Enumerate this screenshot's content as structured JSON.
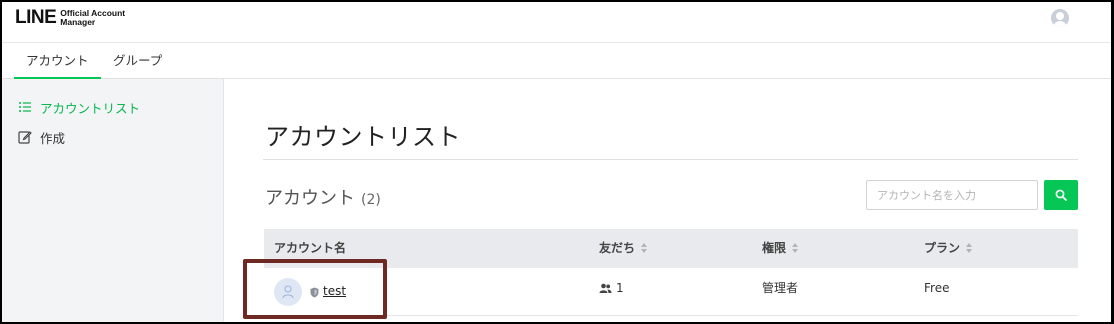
{
  "header": {
    "logo_main": "LINE",
    "logo_sub_line1": "Official Account",
    "logo_sub_line2": "Manager",
    "user_icon": "user-avatar-icon"
  },
  "tabs": [
    {
      "label": "アカウント",
      "active": true
    },
    {
      "label": "グループ",
      "active": false
    }
  ],
  "sidebar": {
    "items": [
      {
        "label": "アカウントリスト",
        "icon": "list-icon",
        "active": true
      },
      {
        "label": "作成",
        "icon": "edit-icon",
        "active": false
      }
    ]
  },
  "main": {
    "page_title": "アカウントリスト",
    "section_title": "アカウント",
    "section_count": "(2)",
    "search_placeholder": "アカウント名を入力",
    "search_icon": "search-icon"
  },
  "table": {
    "columns": [
      "アカウント名",
      "友だち",
      "権限",
      "プラン"
    ],
    "rows": [
      {
        "name": "test",
        "friends": "1",
        "role": "管理者",
        "plan": "Free"
      }
    ]
  },
  "colors": {
    "accent": "#06c755",
    "highlight_border": "#6e2a22"
  }
}
